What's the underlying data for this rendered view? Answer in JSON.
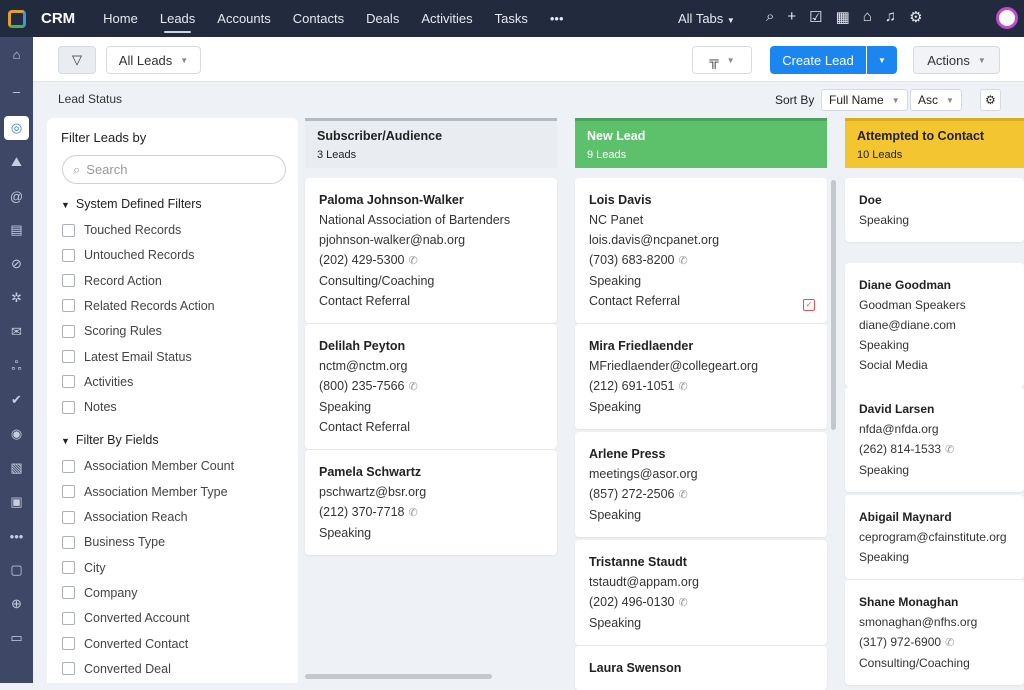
{
  "topbar": {
    "brand": "CRM",
    "nav": [
      "Home",
      "Leads",
      "Accounts",
      "Contacts",
      "Deals",
      "Activities",
      "Tasks",
      "•••"
    ],
    "active": "Leads",
    "all_tabs": "All Tabs",
    "icons": [
      "search-icon",
      "plus-icon",
      "activity-icon",
      "calendar-icon",
      "marketplace-icon",
      "bell-icon",
      "gear-icon"
    ]
  },
  "toolbar": {
    "view": "All Leads",
    "create": "Create Lead",
    "actions": "Actions"
  },
  "subbar": {
    "title": "Lead Status",
    "sort_by": "Sort By",
    "sort_field": "Full Name",
    "sort_order": "Asc"
  },
  "filter": {
    "title": "Filter Leads by",
    "search_placeholder": "Search",
    "system_title": "System Defined Filters",
    "system": [
      "Touched Records",
      "Untouched Records",
      "Record Action",
      "Related Records Action",
      "Scoring Rules",
      "Latest Email Status",
      "Activities",
      "Notes"
    ],
    "fields_title": "Filter By Fields",
    "fields": [
      "Association Member Count",
      "Association Member Type",
      "Association Reach",
      "Business Type",
      "City",
      "Company",
      "Converted Account",
      "Converted Contact",
      "Converted Deal"
    ]
  },
  "columns": [
    {
      "title": "Subscriber/Audience",
      "count": "3 Leads",
      "color": "#e9ecf0",
      "border": "#b6bbc3",
      "text": "#222",
      "cards": [
        {
          "name": "Paloma Johnson-Walker",
          "lines": [
            "National Association of Bartenders",
            "pjohnson-walker@nab.org",
            "(202) 429-5300",
            "Consulting/Coaching",
            "Contact Referral"
          ]
        },
        {
          "name": "Delilah Peyton",
          "lines": [
            "nctm@nctm.org",
            "(800) 235-7566",
            "Speaking",
            "Contact Referral"
          ]
        },
        {
          "name": "Pamela Schwartz",
          "lines": [
            "pschwartz@bsr.org",
            "(212) 370-7718",
            "Speaking"
          ]
        }
      ]
    },
    {
      "title": "New Lead",
      "count": "9 Leads",
      "color": "#5dc16b",
      "border": "#4aa358",
      "text": "#fff",
      "cards": [
        {
          "name": "Lois Davis",
          "lines": [
            "NC Panet",
            "lois.davis@ncpanet.org",
            "(703) 683-8200",
            "Speaking",
            "Contact Referral"
          ],
          "task": true
        },
        {
          "name": "Mira Friedlaender",
          "lines": [
            "MFriedlaender@collegeart.org",
            "(212) 691-1051",
            "Speaking"
          ]
        },
        {
          "name": "Arlene Press",
          "lines": [
            "meetings@asor.org",
            "(857) 272-2506",
            "Speaking"
          ]
        },
        {
          "name": "Tristanne Staudt",
          "lines": [
            "tstaudt@appam.org",
            "(202) 496-0130",
            "Speaking"
          ]
        },
        {
          "name": "Laura Swenson",
          "lines": []
        }
      ]
    },
    {
      "title": "Attempted to Contact",
      "count": "10 Leads",
      "color": "#f2c531",
      "border": "#d9ab1e",
      "text": "#222",
      "cards": [
        {
          "name": "Doe",
          "lines": [
            "Speaking"
          ]
        },
        {
          "name": "Diane Goodman",
          "lines": [
            "Goodman Speakers",
            "diane@diane.com",
            "Speaking",
            "Social Media"
          ]
        },
        {
          "name": "David Larsen",
          "lines": [
            "nfda@nfda.org",
            "(262) 814-1533",
            "Speaking"
          ]
        },
        {
          "name": "Abigail Maynard",
          "lines": [
            "ceprogram@cfainstitute.org",
            "Speaking"
          ]
        },
        {
          "name": "Shane Monaghan",
          "lines": [
            "smonaghan@nfhs.org",
            "(317) 972-6900",
            "Consulting/Coaching"
          ]
        }
      ]
    }
  ]
}
